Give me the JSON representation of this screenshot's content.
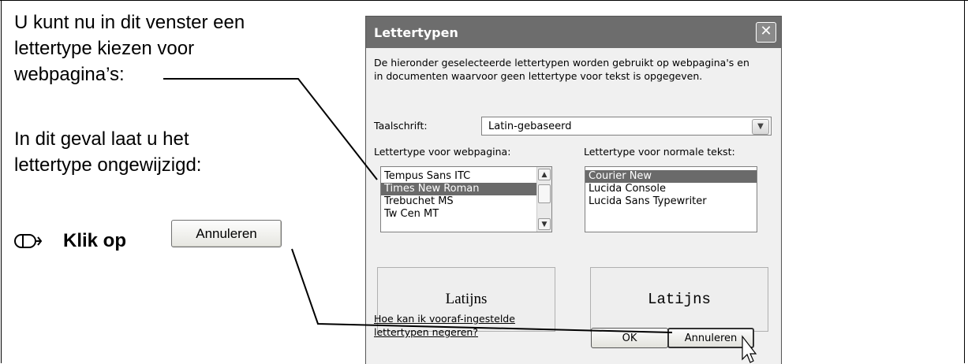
{
  "instructions": {
    "para1": [
      "U kunt nu in dit venster een",
      "lettertype kiezen voor",
      "webpagina’s:"
    ],
    "para2": [
      "In dit geval laat u het",
      "lettertype ongewijzigd:"
    ],
    "klik": "Klik op",
    "inline_button": "Annuleren"
  },
  "dialog": {
    "title": "Lettertypen",
    "close_symbol": "✕",
    "description": "De hieronder geselecteerde lettertypen worden gebruikt op webpagina's en in documenten waarvoor geen lettertype voor tekst is opgegeven.",
    "script_label": "Taalschrift:",
    "script_value": "Latin-gebaseerd",
    "web_font_label": "Lettertype voor webpagina:",
    "plain_font_label": "Lettertype voor normale tekst:",
    "web_fonts": [
      "Tempus Sans ITC",
      "Times New Roman",
      "Trebuchet MS",
      "Tw Cen MT"
    ],
    "web_selected": 1,
    "plain_fonts": [
      "Courier New",
      "Lucida Console",
      "Lucida Sans Typewriter"
    ],
    "plain_selected": 0,
    "preview_web": "Latijns",
    "preview_plain": "Latijns",
    "help_link": "Hoe kan ik vooraf-ingestelde lettertypen negeren?",
    "ok_label": "OK",
    "cancel_label": "Annuleren"
  },
  "icons": {
    "mouse": "mouse-icon"
  }
}
